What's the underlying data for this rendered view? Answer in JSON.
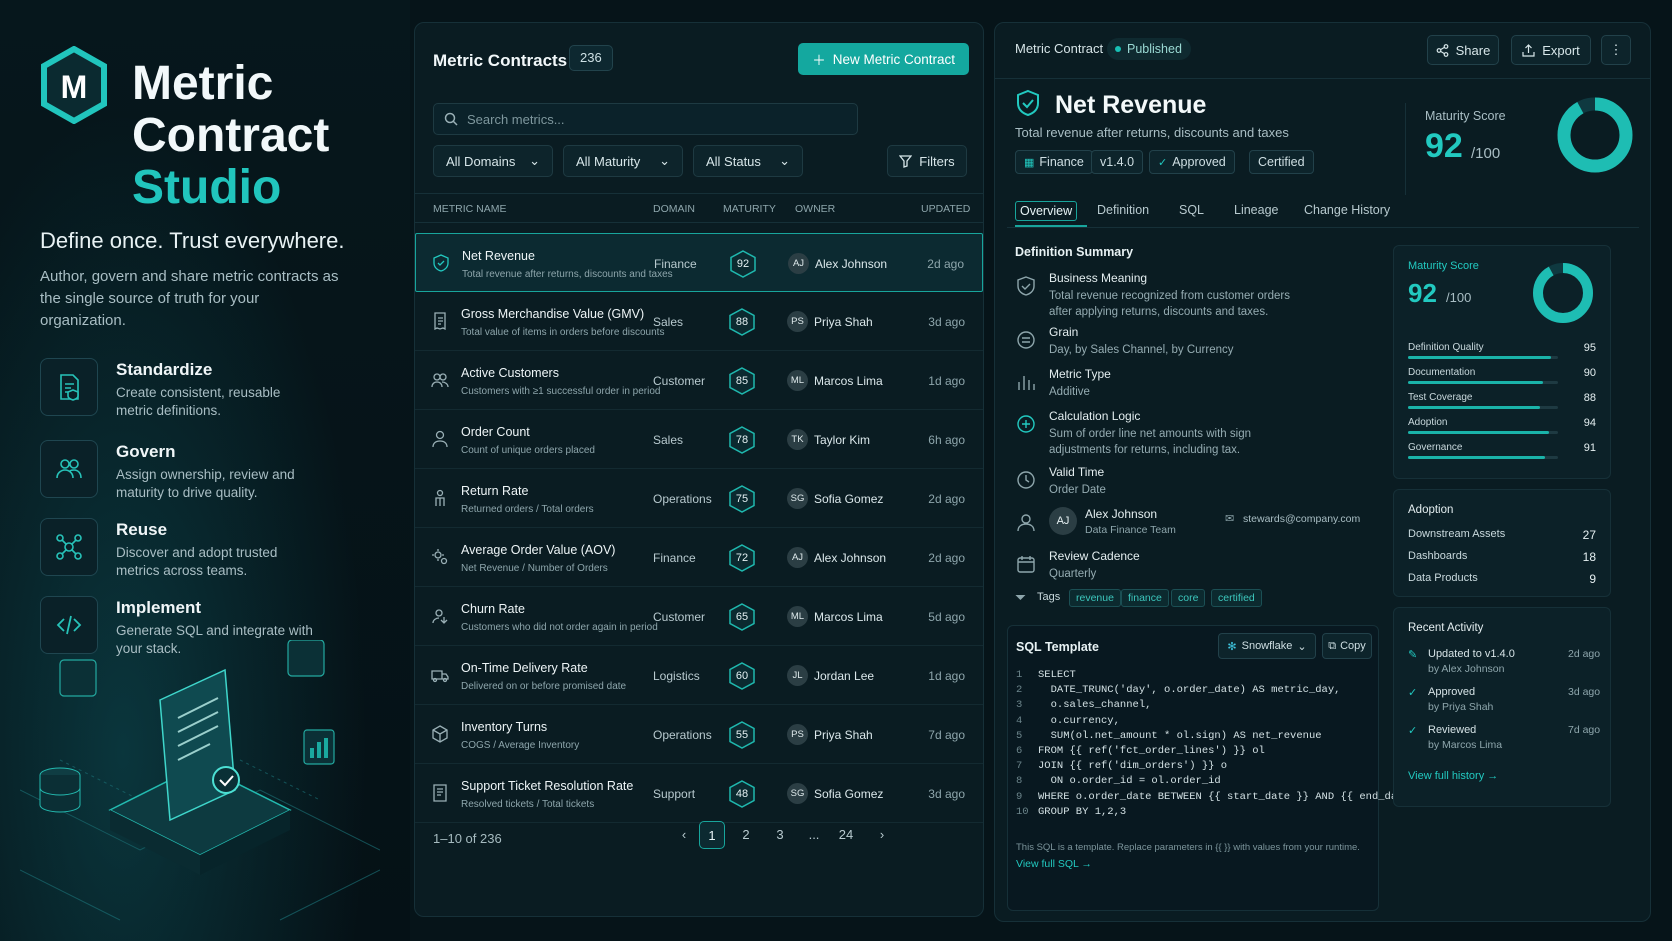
{
  "hero": {
    "title_line1": "Metric",
    "title_line2": "Contract",
    "title_line3": "Studio",
    "tagline": "Define once. Trust everywhere.",
    "description": "Author, govern and share metric contracts as the single source of truth for your organization.",
    "features": [
      {
        "name": "Standardize",
        "desc": "Create consistent, reusable metric definitions.",
        "icon": "document-shield-icon"
      },
      {
        "name": "Govern",
        "desc": "Assign ownership, review and maturity to drive quality.",
        "icon": "users-icon"
      },
      {
        "name": "Reuse",
        "desc": "Discover and adopt trusted metrics across teams.",
        "icon": "network-icon"
      },
      {
        "name": "Implement",
        "desc": "Generate SQL and integrate with your stack.",
        "icon": "code-icon"
      }
    ]
  },
  "list": {
    "title": "Metric Contracts",
    "count": "236",
    "new_button": "New Metric Contract",
    "search_placeholder": "Search metrics...",
    "filters": {
      "domain": "All Domains",
      "maturity": "All Maturity",
      "status": "All Status",
      "button": "Filters"
    },
    "columns": [
      "METRIC NAME",
      "DOMAIN",
      "MATURITY",
      "OWNER",
      "UPDATED"
    ],
    "rows": [
      {
        "name": "Net Revenue",
        "desc": "Total revenue after returns, discounts and taxes",
        "domain": "Finance",
        "maturity": "92",
        "initials": "AJ",
        "owner": "Alex Johnson",
        "updated": "2d ago",
        "icon": "shield-check-icon"
      },
      {
        "name": "Gross Merchandise Value (GMV)",
        "desc": "Total value of items in orders before discounts",
        "domain": "Sales",
        "maturity": "88",
        "initials": "PS",
        "owner": "Priya Shah",
        "updated": "3d ago",
        "icon": "receipt-icon"
      },
      {
        "name": "Active Customers",
        "desc": "Customers with ≥1 successful order in period",
        "domain": "Customer",
        "maturity": "85",
        "initials": "ML",
        "owner": "Marcos Lima",
        "updated": "1d ago",
        "icon": "users-icon"
      },
      {
        "name": "Order Count",
        "desc": "Count of unique orders placed",
        "domain": "Sales",
        "maturity": "78",
        "initials": "TK",
        "owner": "Taylor Kim",
        "updated": "6h ago",
        "icon": "user-icon"
      },
      {
        "name": "Return Rate",
        "desc": "Returned orders / Total orders",
        "domain": "Operations",
        "maturity": "75",
        "initials": "SG",
        "owner": "Sofia Gomez",
        "updated": "2d ago",
        "icon": "return-icon"
      },
      {
        "name": "Average Order Value (AOV)",
        "desc": "Net Revenue / Number of Orders",
        "domain": "Finance",
        "maturity": "72",
        "initials": "AJ",
        "owner": "Alex Johnson",
        "updated": "2d ago",
        "icon": "gears-icon"
      },
      {
        "name": "Churn Rate",
        "desc": "Customers who did not order again in period",
        "domain": "Customer",
        "maturity": "65",
        "initials": "ML",
        "owner": "Marcos Lima",
        "updated": "5d ago",
        "icon": "churn-icon"
      },
      {
        "name": "On-Time Delivery Rate",
        "desc": "Delivered on or before promised date",
        "domain": "Logistics",
        "maturity": "60",
        "initials": "JL",
        "owner": "Jordan Lee",
        "updated": "1d ago",
        "icon": "truck-icon"
      },
      {
        "name": "Inventory Turns",
        "desc": "COGS / Average Inventory",
        "domain": "Operations",
        "maturity": "55",
        "initials": "PS",
        "owner": "Priya Shah",
        "updated": "7d ago",
        "icon": "box-icon"
      },
      {
        "name": "Support Ticket Resolution Rate",
        "desc": "Resolved tickets / Total tickets",
        "domain": "Support",
        "maturity": "48",
        "initials": "SG",
        "owner": "Sofia Gomez",
        "updated": "3d ago",
        "icon": "ticket-icon"
      }
    ],
    "pagination": {
      "range": "1–10 of 236",
      "pages": [
        "1",
        "2",
        "3",
        "...",
        "24"
      ]
    }
  },
  "detail": {
    "breadcrumb": "Metric Contract",
    "status": "Published",
    "share": "Share",
    "export": "Export",
    "title": "Net Revenue",
    "subtitle": "Total revenue after returns, discounts and taxes",
    "chips": {
      "domain": "Finance",
      "version": "v1.4.0",
      "approved": "Approved",
      "certified": "Certified"
    },
    "maturity_label": "Maturity Score",
    "maturity_value": "92",
    "maturity_of": "/100",
    "maturity_fraction": 0.92,
    "tabs": [
      "Overview",
      "Definition",
      "SQL",
      "Lineage",
      "Change History"
    ],
    "summary_title": "Definition Summary",
    "business_meaning": {
      "title": "Business Meaning",
      "text": "Total revenue recognized from customer orders after applying returns, discounts and taxes."
    },
    "grain": {
      "title": "Grain",
      "text": "Day, by Sales Channel, by Currency"
    },
    "metric_type": {
      "title": "Metric Type",
      "text": "Additive"
    },
    "calc_logic": {
      "title": "Calculation Logic",
      "text": "Sum of order line net amounts with sign adjustments for returns, including tax."
    },
    "valid_time": {
      "title": "Valid Time",
      "text": "Order Date"
    },
    "owner": {
      "initials": "AJ",
      "name": "Alex Johnson",
      "team": "Data Finance Team",
      "email": "stewards@company.com"
    },
    "review": {
      "title": "Review Cadence",
      "text": "Quarterly"
    },
    "tags_label": "Tags",
    "tags": [
      "revenue",
      "finance",
      "core",
      "certified"
    ],
    "sql": {
      "title": "SQL Template",
      "engine": "Snowflake",
      "copy": "Copy",
      "lines": [
        "SELECT",
        "  DATE_TRUNC('day', o.order_date) AS metric_day,",
        "  o.sales_channel,",
        "  o.currency,",
        "  SUM(ol.net_amount * ol.sign) AS net_revenue",
        "FROM {{ ref('fct_order_lines') }} ol",
        "JOIN {{ ref('dim_orders') }} o",
        "  ON o.order_id = ol.order_id",
        "WHERE o.order_date BETWEEN {{ start_date }} AND {{ end_date }}",
        "GROUP BY 1,2,3"
      ],
      "note": "This SQL is a template. Replace parameters in {{ }} with values from your runtime.",
      "link": "View full SQL →"
    },
    "score_card": {
      "label": "Maturity Score",
      "value": "92",
      "of": "/100",
      "fraction": 0.92,
      "items": [
        {
          "name": "Definition Quality",
          "value": "95"
        },
        {
          "name": "Documentation",
          "value": "90"
        },
        {
          "name": "Test Coverage",
          "value": "88"
        },
        {
          "name": "Adoption",
          "value": "94"
        },
        {
          "name": "Governance",
          "value": "91"
        }
      ]
    },
    "adoption": {
      "title": "Adoption",
      "items": [
        {
          "name": "Downstream Assets",
          "value": "27"
        },
        {
          "name": "Dashboards",
          "value": "18"
        },
        {
          "name": "Data Products",
          "value": "9"
        }
      ]
    },
    "activity": {
      "title": "Recent Activity",
      "items": [
        {
          "action": "Updated to v1.4.0",
          "by": "by Alex Johnson",
          "when": "2d ago"
        },
        {
          "action": "Approved",
          "by": "by Priya Shah",
          "when": "3d ago"
        },
        {
          "action": "Reviewed",
          "by": "by Marcos Lima",
          "when": "7d ago"
        }
      ],
      "link": "View full history →"
    }
  },
  "colors": {
    "accent": "#18a59c",
    "background": "#061419"
  }
}
